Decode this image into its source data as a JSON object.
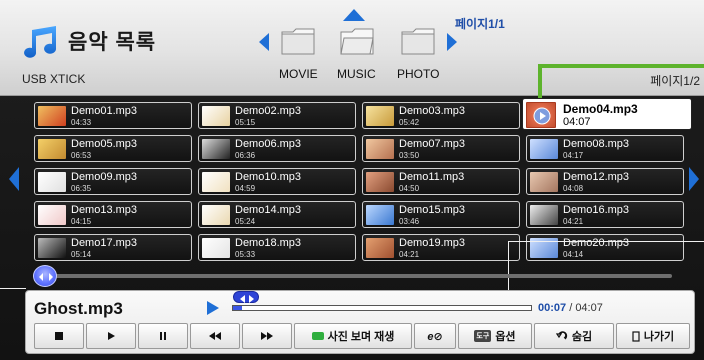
{
  "header": {
    "title": "음악 목록",
    "device": "USB XTICK",
    "page_top": "페이지1/1",
    "page_right": "페이지1/2",
    "categories": [
      {
        "label": "MOVIE",
        "icon": "folder-icon"
      },
      {
        "label": "MUSIC",
        "icon": "folder-open-icon",
        "selected": true
      },
      {
        "label": "PHOTO",
        "icon": "folder-icon"
      }
    ]
  },
  "tracks": [
    {
      "name": "Demo01.mp3",
      "duration": "04:33"
    },
    {
      "name": "Demo02.mp3",
      "duration": "05:15"
    },
    {
      "name": "Demo03.mp3",
      "duration": "05:42"
    },
    {
      "name": "Demo04.mp3",
      "duration": "04:07",
      "selected": true
    },
    {
      "name": "Demo05.mp3",
      "duration": "06:53"
    },
    {
      "name": "Demo06.mp3",
      "duration": "06:36"
    },
    {
      "name": "Demo07.mp3",
      "duration": "03:50"
    },
    {
      "name": "Demo08.mp3",
      "duration": "04:17"
    },
    {
      "name": "Demo09.mp3",
      "duration": "06:35"
    },
    {
      "name": "Demo10.mp3",
      "duration": "04:59"
    },
    {
      "name": "Demo11.mp3",
      "duration": "04:50"
    },
    {
      "name": "Demo12.mp3",
      "duration": "04:08"
    },
    {
      "name": "Demo13.mp3",
      "duration": "04:15"
    },
    {
      "name": "Demo14.mp3",
      "duration": "05:24"
    },
    {
      "name": "Demo15.mp3",
      "duration": "03:46"
    },
    {
      "name": "Demo16.mp3",
      "duration": "04:21"
    },
    {
      "name": "Demo17.mp3",
      "duration": "05:14"
    },
    {
      "name": "Demo18.mp3",
      "duration": "05:33"
    },
    {
      "name": "Demo19.mp3",
      "duration": "04:21"
    },
    {
      "name": "Demo20.mp3",
      "duration": "04:14"
    }
  ],
  "player": {
    "title": "Ghost.mp3",
    "current_time": "00:07",
    "separator": " / ",
    "total_time": "04:07",
    "progress": 0.03
  },
  "controls": {
    "stop": "stop-icon",
    "play": "play-icon",
    "pause": "pause-icon",
    "rewind": "rewind-icon",
    "forward": "fast-forward-icon",
    "photo_slideshow": "사진 보며 재생",
    "eq_label": "e⊘",
    "options": "옵션",
    "options_badge": "도구",
    "hide": "숨김",
    "exit": "나가기"
  },
  "colors": {
    "accent_blue": "#1f6fd6",
    "highlight_green": "#5db32c",
    "progress_blue": "#3b56e6"
  }
}
